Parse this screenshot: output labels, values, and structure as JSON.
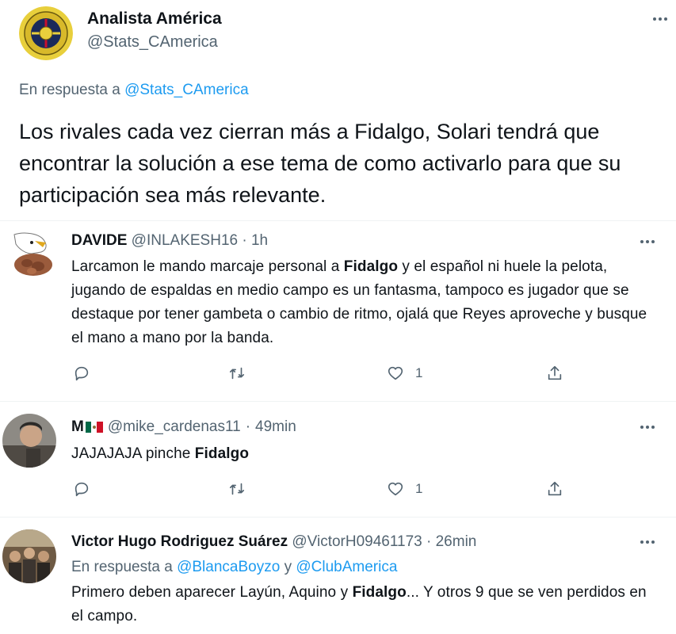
{
  "main_tweet": {
    "author_name": "Analista América",
    "handle": "@Stats_CAmerica",
    "in_reply_prefix": "En respuesta a",
    "in_reply_handle": "@Stats_CAmerica",
    "text": "Los rivales cada vez cierran más a Fidalgo, Solari tendrá que encontrar la solución a ese tema de como activarlo para que su participación sea más relevante."
  },
  "replies": [
    {
      "author_name": "DAVIDE",
      "handle": "@INLAKESH16",
      "separator": "·",
      "time": "1h",
      "text_parts": [
        "Larcamon le mando marcaje personal a ",
        "Fidalgo",
        " y el español ni huele la pelota, jugando de espaldas en medio campo es un fantasma, tampoco es jugador que se destaque por tener gambeta o cambio de ritmo, ojalá que Reyes aproveche y busque el mano a mano por la banda."
      ],
      "like_count": "1"
    },
    {
      "author_name": "M",
      "author_flag": "mexico-flag",
      "handle": "@mike_cardenas11",
      "separator": "·",
      "time": "49min",
      "text_parts": [
        "JAJAJAJA pinche ",
        "Fidalgo",
        ""
      ],
      "like_count": "1"
    },
    {
      "author_name": "Victor Hugo Rodriguez Suárez",
      "handle": "@VictorH09461173",
      "separator": "·",
      "time": "26min",
      "in_reply_prefix": "En respuesta a",
      "in_reply_handle_1": "@BlancaBoyzo",
      "in_reply_joiner": "y",
      "in_reply_handle_2": "@ClubAmerica",
      "text_parts": [
        "Primero deben aparecer Layún, Aquino y ",
        "Fidalgo",
        "... Y otros 9 que se ven perdidos en el campo."
      ]
    }
  ],
  "icons": [
    "more-icon",
    "reply-icon",
    "retweet-icon",
    "like-icon",
    "share-icon"
  ],
  "colors": {
    "link": "#1d9bf0",
    "muted": "#536471",
    "text": "#0f1419",
    "divider": "#eff3f4",
    "club_yellow": "#f2d33a",
    "club_navy": "#1a2a5a"
  }
}
